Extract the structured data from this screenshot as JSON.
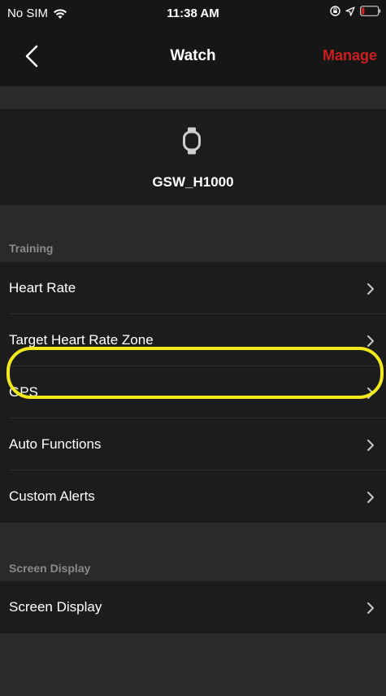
{
  "status_bar": {
    "carrier": "No SIM",
    "time": "11:38 AM"
  },
  "nav": {
    "title": "Watch",
    "manage_label": "Manage"
  },
  "device": {
    "name": "GSW_H1000"
  },
  "sections": [
    {
      "header": "Training",
      "items": [
        {
          "label": "Heart Rate"
        },
        {
          "label": "Target Heart Rate Zone"
        },
        {
          "label": "GPS"
        },
        {
          "label": "Auto Functions"
        },
        {
          "label": "Custom Alerts"
        }
      ]
    },
    {
      "header": "Screen Display",
      "items": [
        {
          "label": "Screen Display"
        }
      ]
    }
  ],
  "colors": {
    "accent": "#cc1f1f",
    "highlight": "#f2e81e",
    "background": "#2a2a2a",
    "cell": "#1c1c1c"
  }
}
